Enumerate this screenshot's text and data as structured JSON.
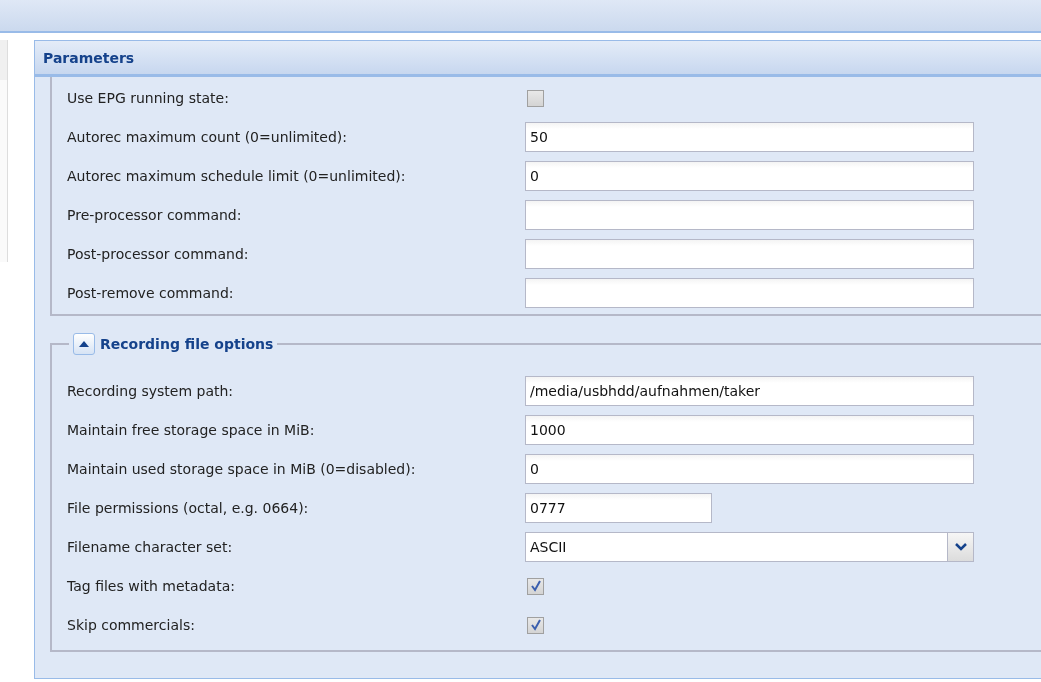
{
  "panel": {
    "title": "Parameters"
  },
  "general": [
    {
      "kind": "checkbox",
      "label": "Use EPG running state:",
      "checked": false
    },
    {
      "kind": "text",
      "label": "Autorec maximum count (0=unlimited):",
      "value": "50"
    },
    {
      "kind": "text",
      "label": "Autorec maximum schedule limit (0=unlimited):",
      "value": "0"
    },
    {
      "kind": "text",
      "label": "Pre-processor command:"
    },
    {
      "kind": "text",
      "label": "Post-processor command:"
    },
    {
      "kind": "text",
      "label": "Post-remove command:"
    }
  ],
  "file_options": {
    "title": "Recording file options",
    "expanded": true,
    "rows": [
      {
        "kind": "text",
        "label": "Recording system path:",
        "value": "/media/usbhdd/aufnahmen/taker"
      },
      {
        "kind": "text",
        "label": "Maintain free storage space in MiB:",
        "value": "1000"
      },
      {
        "kind": "text",
        "label": "Maintain used storage space in MiB (0=disabled):",
        "value": "0"
      },
      {
        "kind": "short",
        "label": "File permissions (octal, e.g. 0664):",
        "value": "0777"
      },
      {
        "kind": "combo",
        "label": "Filename character set:",
        "value": "ASCII"
      },
      {
        "kind": "checkbox",
        "label": "Tag files with metadata:",
        "checked": true
      },
      {
        "kind": "checkbox",
        "label": "Skip commercials:",
        "checked": true
      }
    ]
  }
}
